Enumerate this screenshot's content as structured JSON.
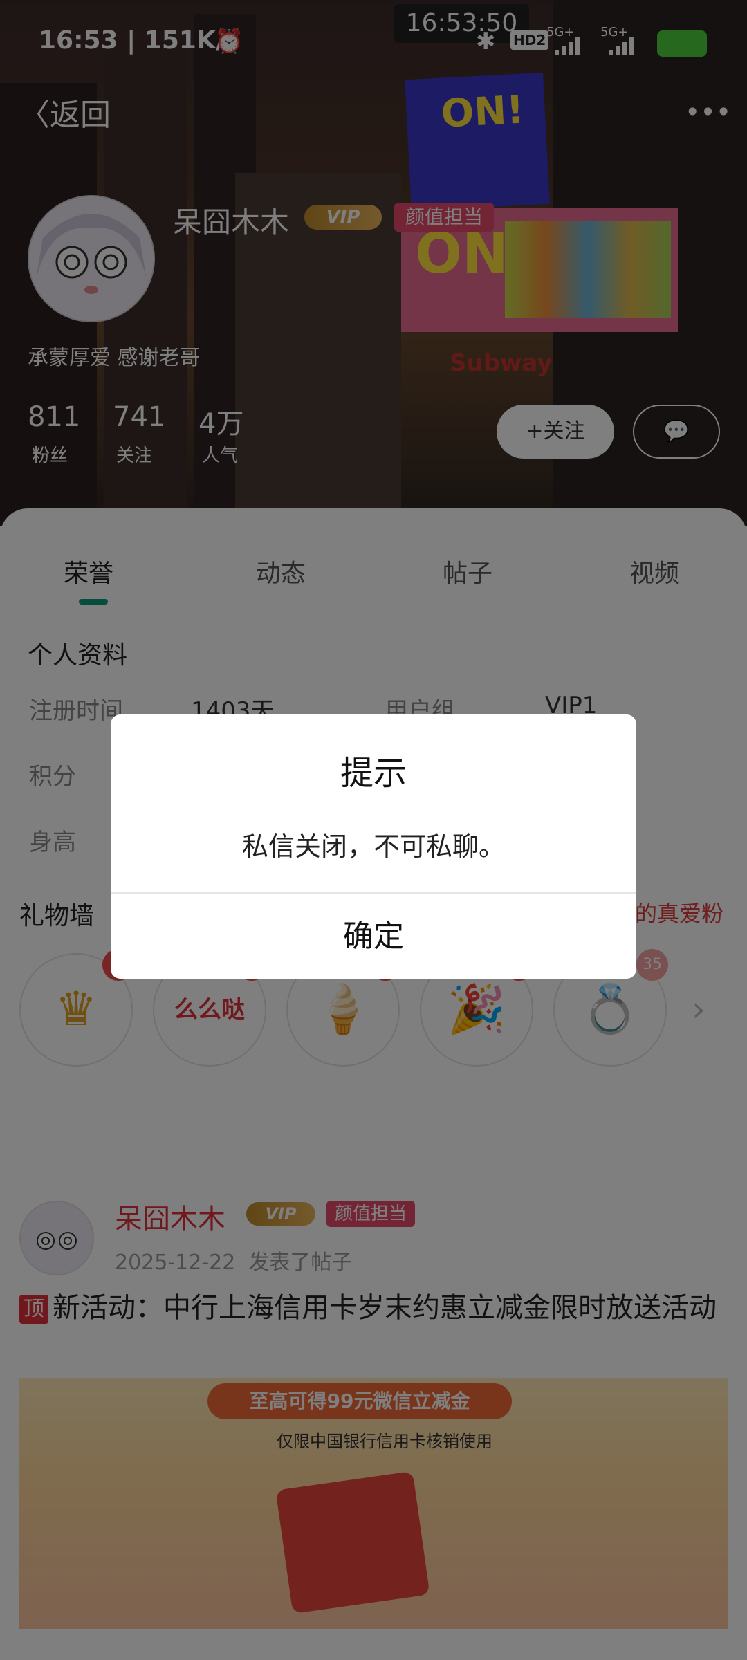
{
  "status_bar": {
    "time_speed": "16:53 | 151K/s",
    "clock_overlay": "16:53:50",
    "hd_label": "HD2",
    "net1": "5G+",
    "net2": "5G+"
  },
  "header": {
    "back_label": "返回",
    "more_icon": "more-dots-icon"
  },
  "profile": {
    "username": "呆囧木木",
    "vip_label": "VIP",
    "tag_label": "颜值担当",
    "bio": "承蒙厚爱 感谢老哥",
    "stats": [
      {
        "value": "811",
        "label": "粉丝"
      },
      {
        "value": "741",
        "label": "关注"
      },
      {
        "value": "4万",
        "label": "人气"
      }
    ],
    "follow_label": "+关注",
    "message_icon": "chat-bubble-icon"
  },
  "tabs": [
    "荣誉",
    "动态",
    "帖子",
    "视频"
  ],
  "active_tab": "荣誉",
  "personal_info": {
    "title": "个人资料",
    "reg_label": "注册时间",
    "reg_value": "1403天",
    "group_label": "用户组",
    "group_value": "VIP1",
    "points_label": "积分",
    "height_label": "身高"
  },
  "gift_wall": {
    "title": "礼物墙",
    "right_text": "的真爱粉",
    "gifts": [
      {
        "icon": "crown-icon",
        "glyph": "♛",
        "badge": ""
      },
      {
        "icon": "candy-text-icon",
        "glyph": "么么哒",
        "badge": ""
      },
      {
        "icon": "ice-cream-icon",
        "glyph": "🍦",
        "badge": ""
      },
      {
        "icon": "party-popper-icon",
        "glyph": "🎉",
        "badge": ""
      },
      {
        "icon": "ring-icon",
        "glyph": "💍",
        "badge": "35"
      }
    ]
  },
  "post": {
    "username": "呆囧木木",
    "vip_label": "VIP",
    "tag_label": "颜值担当",
    "date": "2025-12-22",
    "action": "发表了帖子",
    "top_tag": "顶",
    "title": "新活动：中行上海信用卡岁末约惠立减金限时放送活动",
    "banner_pill": "至高可得99元微信立减金",
    "banner_sub": "仅限中国银行信用卡核销使用"
  },
  "dialog": {
    "title": "提示",
    "message": "私信关闭，不可私聊。",
    "confirm": "确定"
  }
}
